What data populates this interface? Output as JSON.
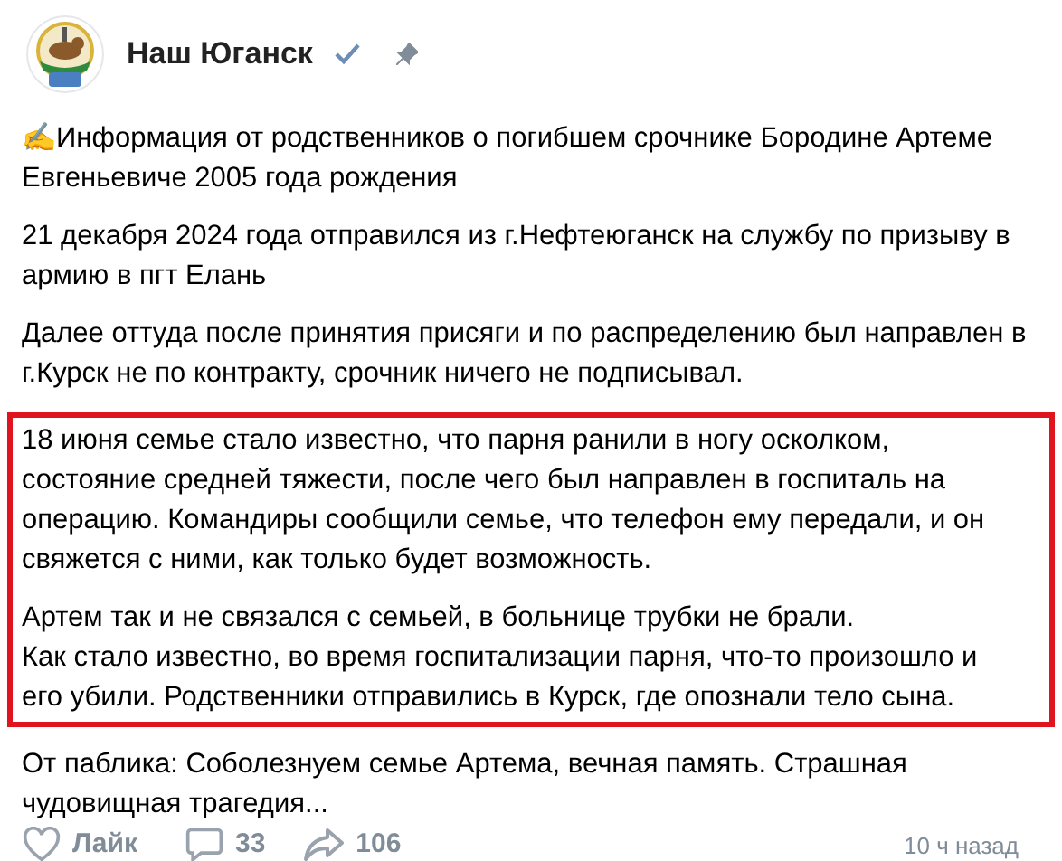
{
  "post": {
    "author": "Наш Юганск",
    "verified": true,
    "pinned": true,
    "paragraphs": [
      {
        "text": "✍️Информация от родственников о погибшем срочнике Бородине Артеме Евгеньевиче 2005 года рождения",
        "highlighted": false
      },
      {
        "text": "21 декабря 2024 года отправился из г.Нефтеюганск на службу по призыву в армию в пгт Елань",
        "highlighted": false
      },
      {
        "text": "Далее оттуда после принятия присяги и по распределению был направлен в г.Курск не по контракту, срочник ничего не подписывал.",
        "highlighted": false
      },
      {
        "text": "18 июня семье стало известно, что парня ранили в ногу осколком, состояние средней тяжести, после чего был направлен в госпиталь на операцию. Командиры сообщили семье, что телефон ему передали, и он свяжется с ними, как только будет возможность.",
        "highlighted": true
      },
      {
        "text": "Артем так и не связался с семьей, в больнице трубки не брали.\nКак стало известно, во время госпитализации парня, что-то произошло и его убили. Родственники отправились в Курск, где опознали тело сына.",
        "highlighted": true
      },
      {
        "text": "От паблика: Соболезнуем семье Артема, вечная память. Страшная чудовищная трагедия...",
        "highlighted": false
      }
    ],
    "like_label": "Лайк",
    "comments": "33",
    "shares": "106",
    "time": "10 ч назад"
  }
}
